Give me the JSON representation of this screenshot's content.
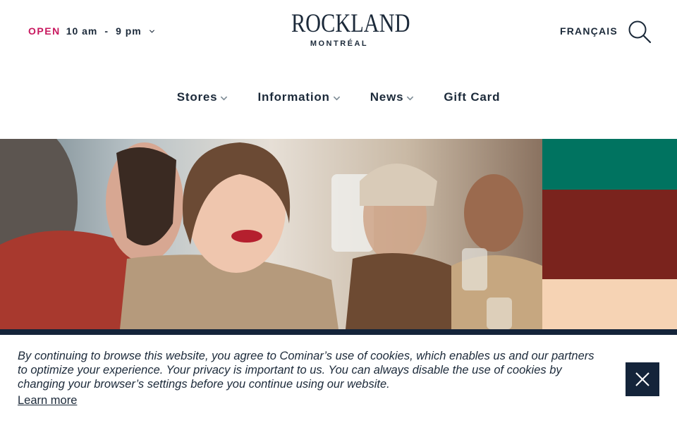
{
  "header": {
    "hours": {
      "status": "OPEN",
      "open_time": "10 am",
      "separator": "-",
      "close_time": "9 pm"
    },
    "logo": {
      "name": "ROCKLAND",
      "city": "MONTRÉAL"
    },
    "language_toggle": "FRANÇAIS",
    "search_icon": "search-icon"
  },
  "nav": {
    "items": [
      {
        "label": "Stores",
        "has_dropdown": true
      },
      {
        "label": "Information",
        "has_dropdown": true
      },
      {
        "label": "News",
        "has_dropdown": true
      },
      {
        "label": "Gift Card",
        "has_dropdown": false
      }
    ]
  },
  "hero": {
    "swatches": [
      {
        "color": "#007360"
      },
      {
        "color": "#7a231d"
      },
      {
        "color": "#f6d3b4"
      }
    ]
  },
  "cookie_banner": {
    "message": "By continuing to browse this website, you agree to Cominar’s use of cookies, which enables us and our partners to optimize your experience. Your privacy is important to us. You can always disable the use of cookies by changing your browser’s settings before you continue using our website.",
    "learn_more": "Learn more",
    "close_icon": "close-icon"
  },
  "colors": {
    "accent": "#c8185f",
    "navy": "#14243a",
    "text": "#1c2a3a"
  }
}
